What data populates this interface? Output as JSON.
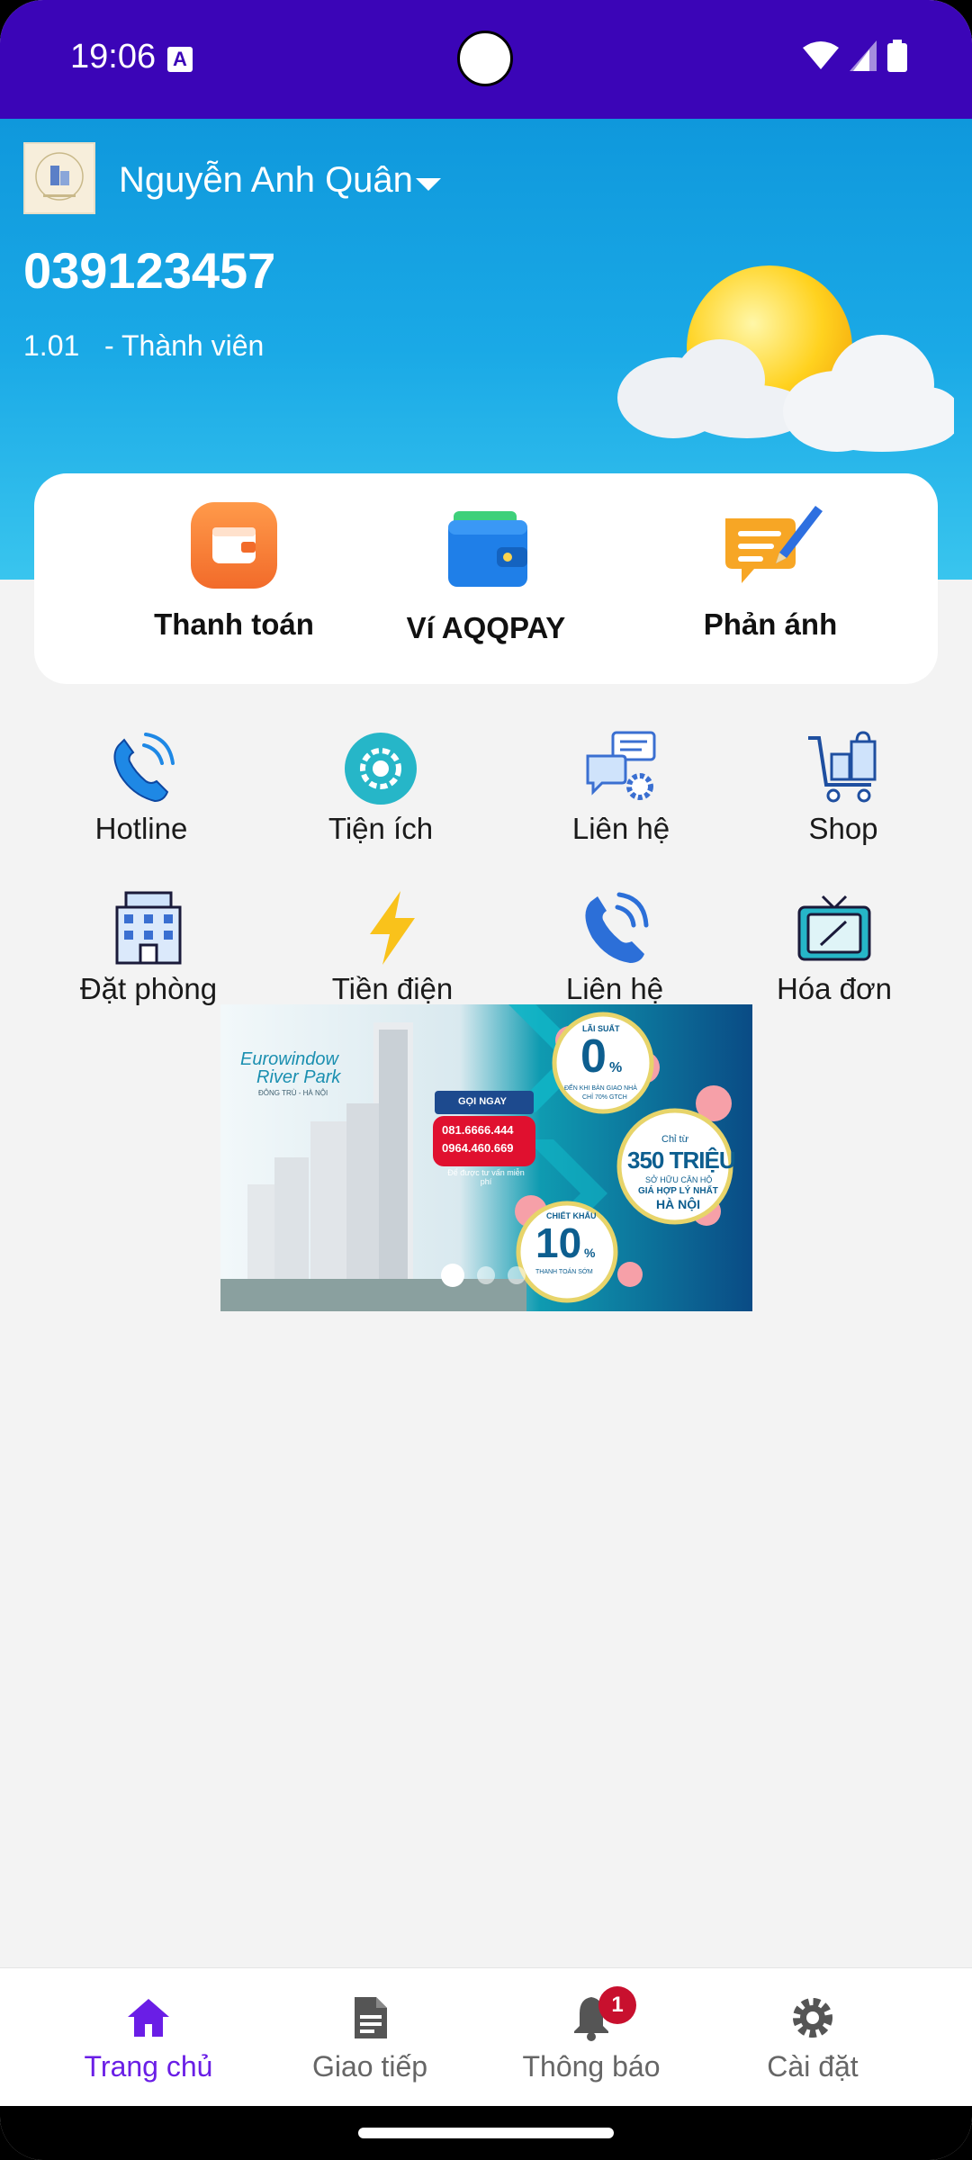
{
  "status_bar": {
    "time": "19:06",
    "a_glyph": "A"
  },
  "header": {
    "user_name": "Nguyễn Anh Quân",
    "phone": "039123457",
    "level": "1.01",
    "role": "- Thành viên"
  },
  "quick_actions": [
    {
      "label": "Thanh toán",
      "icon": "wallet-card-icon"
    },
    {
      "label": "Ví AQQPAY",
      "icon": "blue-wallet-icon"
    },
    {
      "label": "Phản ánh",
      "icon": "feedback-note-icon"
    }
  ],
  "grid": [
    {
      "label": "Hotline",
      "icon": "phone-ringing-icon"
    },
    {
      "label": "Tiện ích",
      "icon": "utility-gear-icon"
    },
    {
      "label": "Liên hệ",
      "icon": "chat-settings-icon"
    },
    {
      "label": "Shop",
      "icon": "shopping-cart-icon"
    },
    {
      "label": "Đặt phòng",
      "icon": "building-icon"
    },
    {
      "label": "Tiền điện",
      "icon": "lightning-icon"
    },
    {
      "label": "Liên hệ",
      "icon": "phone-call-icon"
    },
    {
      "label": "Hóa đơn",
      "icon": "tv-icon"
    }
  ],
  "banner": {
    "brand_line1": "Eurowindow",
    "brand_line2": "River Park",
    "brand_sub": "ĐÔNG TRÙ - HÀ NỘI",
    "call_title": "GỌI NGAY",
    "call_phone1": "081.6666.444",
    "call_phone2": "0964.460.669",
    "call_note": "Để được tư vấn miễn phí",
    "rate_title": "LÃI SUẤT",
    "rate_value": "0",
    "rate_unit": "%",
    "rate_note1": "ĐẾN KHI BÀN GIAO NHÀ",
    "rate_note2": "CHỈ 70% GTCH",
    "price_from": "Chỉ từ",
    "price_value": "350 TRIỆU",
    "price_note1": "SỞ HỮU CĂN HỘ",
    "price_note2": "GIÁ HỢP LÝ NHẤT",
    "price_note3": "HÀ NỘI",
    "discount_title": "CHIẾT KHẤU",
    "discount_value": "10",
    "discount_unit": "%",
    "discount_note": "THANH TOÁN SỚM",
    "slides": 3,
    "active_slide": 1
  },
  "bottom_nav": [
    {
      "label": "Trang chủ",
      "icon": "home-icon",
      "active": true
    },
    {
      "label": "Giao tiếp",
      "icon": "document-icon",
      "active": false
    },
    {
      "label": "Thông báo",
      "icon": "bell-icon",
      "active": false,
      "badge": "1"
    },
    {
      "label": "Cài đặt",
      "icon": "gear-icon",
      "active": false
    }
  ],
  "colors": {
    "status_bar": "#3b05b7",
    "header_top": "#0f98dc",
    "active_nav": "#6a1ee6",
    "badge": "#c8102e"
  }
}
